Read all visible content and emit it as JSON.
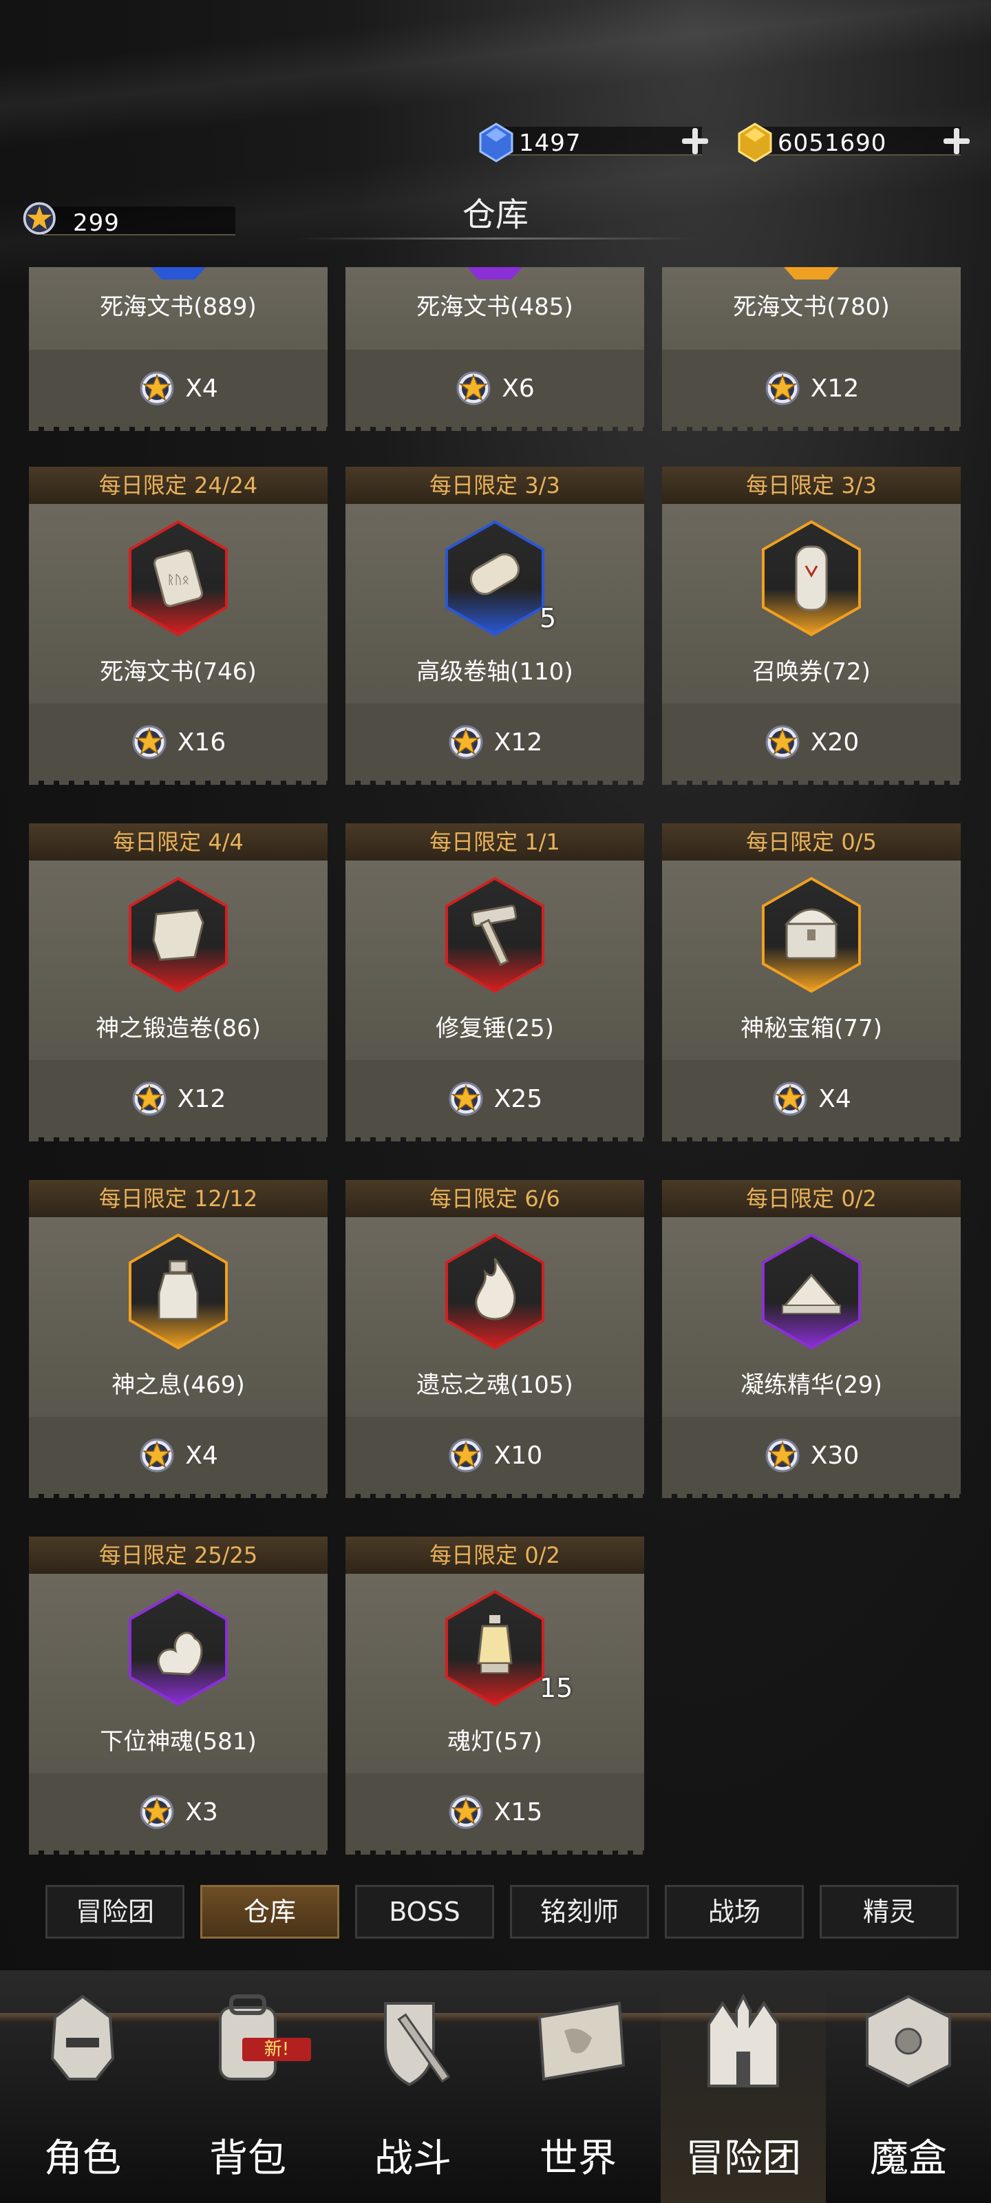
{
  "currency": {
    "crystal": "1497",
    "gold": "6051690",
    "star_coin": "299"
  },
  "title": "仓库",
  "partial_items": [
    {
      "name": "死海文书(889)",
      "price": "X4",
      "color": "#2a57d6"
    },
    {
      "name": "死海文书(485)",
      "price": "X6",
      "color": "#8b2fd6"
    },
    {
      "name": "死海文书(780)",
      "price": "X12",
      "color": "#f0a020"
    }
  ],
  "items": [
    {
      "limit": "每日限定 24/24",
      "name": "死海文书(746)",
      "price": "X16",
      "count": "",
      "icon": "stone-tablet-icon",
      "rarity": "#d22020"
    },
    {
      "limit": "每日限定 3/3",
      "name": "高级卷轴(110)",
      "price": "X12",
      "count": "5",
      "icon": "scroll-icon",
      "rarity": "#2a57d6"
    },
    {
      "limit": "每日限定 3/3",
      "name": "召唤券(72)",
      "price": "X20",
      "count": "",
      "icon": "summon-ticket-icon",
      "rarity": "#f0a020"
    },
    {
      "limit": "每日限定 4/4",
      "name": "神之锻造卷(86)",
      "price": "X12",
      "count": "",
      "icon": "forge-scroll-icon",
      "rarity": "#d22020"
    },
    {
      "limit": "每日限定 1/1",
      "name": "修复锤(25)",
      "price": "X25",
      "count": "",
      "icon": "hammer-icon",
      "rarity": "#d22020"
    },
    {
      "limit": "每日限定 0/5",
      "name": "神秘宝箱(77)",
      "price": "X4",
      "count": "",
      "icon": "treasure-chest-icon",
      "rarity": "#f0a020"
    },
    {
      "limit": "每日限定 12/12",
      "name": "神之息(469)",
      "price": "X4",
      "count": "",
      "icon": "bottle-icon",
      "rarity": "#f0a020"
    },
    {
      "limit": "每日限定 6/6",
      "name": "遗忘之魂(105)",
      "price": "X10",
      "count": "",
      "icon": "flame-soul-icon",
      "rarity": "#d22020"
    },
    {
      "limit": "每日限定 0/2",
      "name": "凝练精华(29)",
      "price": "X30",
      "count": "",
      "icon": "essence-pile-icon",
      "rarity": "#8b2fd6"
    },
    {
      "limit": "每日限定 25/25",
      "name": "下位神魂(581)",
      "price": "X3",
      "count": "",
      "icon": "ghost-soul-icon",
      "rarity": "#8b2fd6"
    },
    {
      "limit": "每日限定 0/2",
      "name": "魂灯(57)",
      "price": "X15",
      "count": "15",
      "icon": "lantern-icon",
      "rarity": "#d22020"
    }
  ],
  "subtabs": [
    "冒险团",
    "仓库",
    "BOSS",
    "铭刻师",
    "战场",
    "精灵"
  ],
  "nav": [
    {
      "label": "角色",
      "icon": "helmet-icon"
    },
    {
      "label": "背包",
      "icon": "backpack-icon",
      "badge": "新!"
    },
    {
      "label": "战斗",
      "icon": "shield-sword-icon"
    },
    {
      "label": "世界",
      "icon": "world-map-icon"
    },
    {
      "label": "冒险团",
      "icon": "castle-icon"
    },
    {
      "label": "魔盒",
      "icon": "magic-cube-icon"
    }
  ]
}
